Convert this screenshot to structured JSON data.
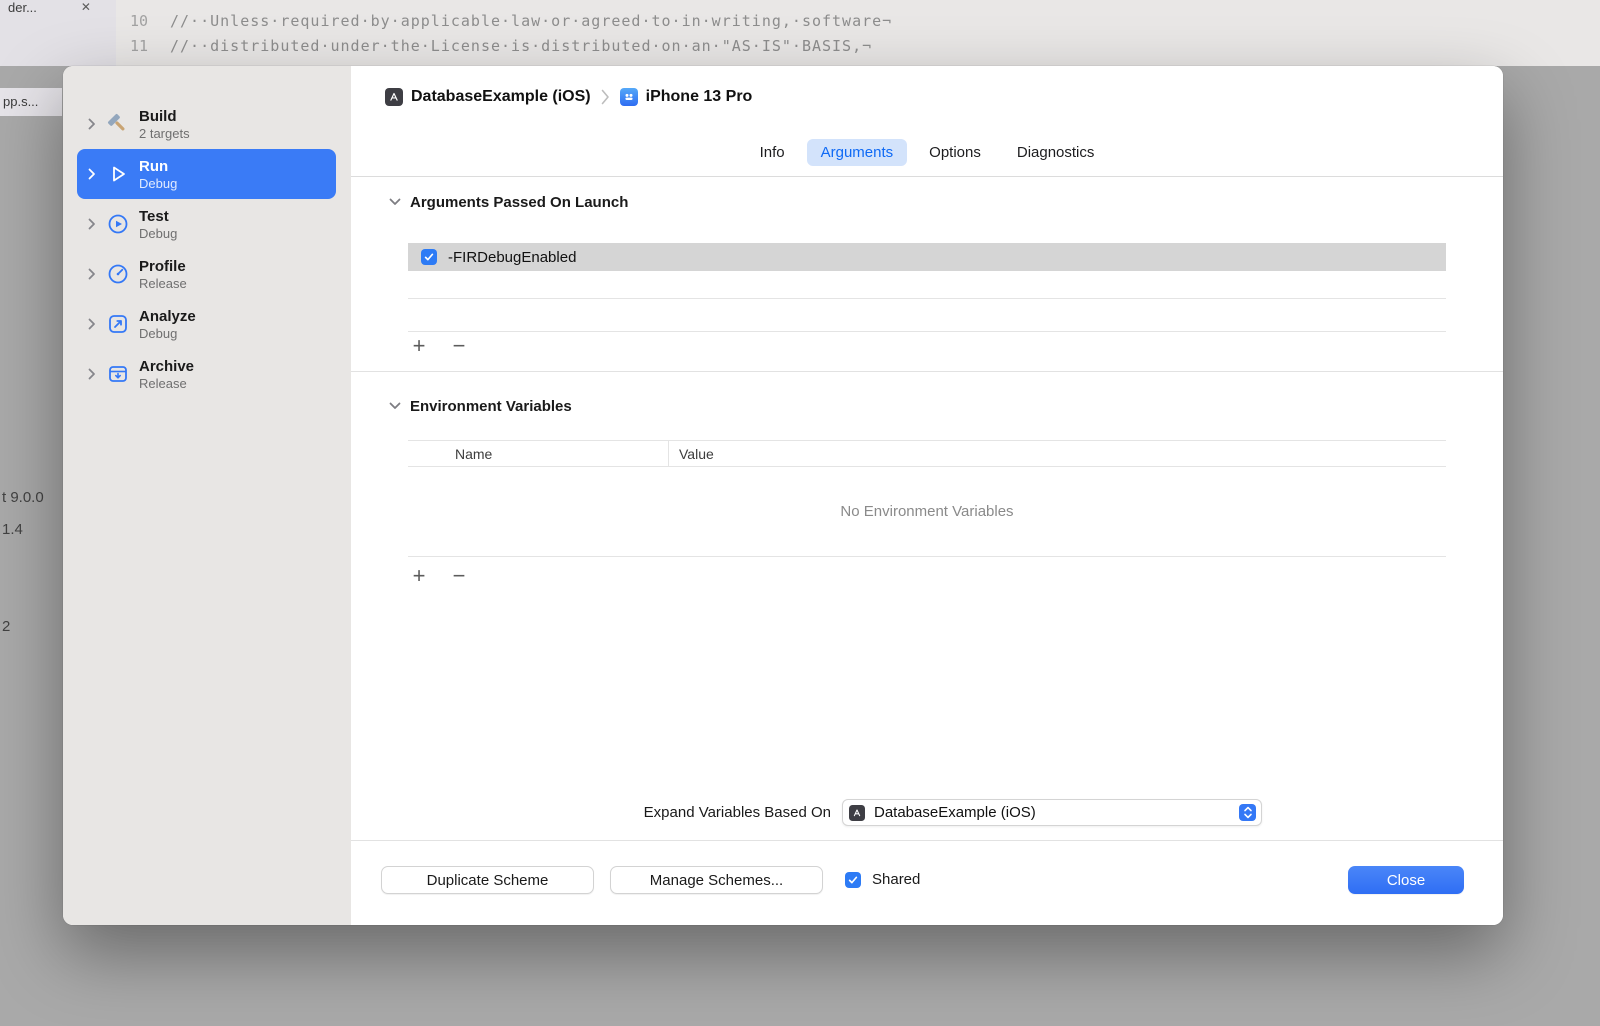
{
  "background": {
    "top_tab": {
      "label": "der...",
      "close": "✕"
    },
    "side_tab": "pp.s...",
    "code_lines": [
      {
        "number": "10",
        "text": "//··Unless·required·by·applicable·law·or·agreed·to·in·writing,·software¬"
      },
      {
        "number": "11",
        "text": "//··distributed·under·the·License·is·distributed·on·an·\"AS·IS\"·BASIS,¬"
      }
    ],
    "fragments": [
      "t 9.0.0",
      "1.4",
      "2"
    ]
  },
  "dialog": {
    "sidebar": {
      "items": [
        {
          "label": "Build",
          "sub": "2 targets",
          "icon": "hammer-icon",
          "selected": false
        },
        {
          "label": "Run",
          "sub": "Debug",
          "icon": "play-icon",
          "selected": true
        },
        {
          "label": "Test",
          "sub": "Debug",
          "icon": "test-play-icon",
          "selected": false
        },
        {
          "label": "Profile",
          "sub": "Release",
          "icon": "gauge-icon",
          "selected": false
        },
        {
          "label": "Analyze",
          "sub": "Debug",
          "icon": "analyze-icon",
          "selected": false
        },
        {
          "label": "Archive",
          "sub": "Release",
          "icon": "archive-box-icon",
          "selected": false
        }
      ]
    },
    "header": {
      "scheme": "DatabaseExample (iOS)",
      "destination": "iPhone 13 Pro"
    },
    "tabs": [
      "Info",
      "Arguments",
      "Options",
      "Diagnostics"
    ],
    "active_tab": "Arguments",
    "arguments": {
      "title": "Arguments Passed On Launch",
      "rows": [
        {
          "checked": true,
          "label": "-FIRDebugEnabled"
        }
      ]
    },
    "environment": {
      "title": "Environment Variables",
      "columns": [
        "Name",
        "Value"
      ],
      "empty": "No Environment Variables"
    },
    "expand": {
      "label": "Expand Variables Based On",
      "value": "DatabaseExample (iOS)"
    },
    "controls": {
      "add": "+",
      "remove": "−"
    },
    "footer": {
      "duplicate": "Duplicate Scheme",
      "manage": "Manage Schemes...",
      "shared": "Shared",
      "close": "Close"
    }
  },
  "colors": {
    "accent": "#3478f6",
    "sidebar_selection": "#3a7bf6",
    "tab_highlight": "#d3e3fb",
    "tab_highlight_text": "#0f6af5",
    "selected_row": "#d5d5d5",
    "sidebar_bg": "#e8e6e4"
  }
}
